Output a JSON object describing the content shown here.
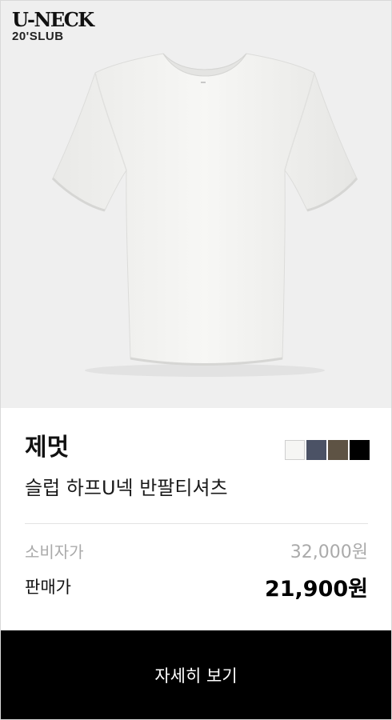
{
  "badge": {
    "title": "U-NECK",
    "subtitle": "20'SLUB"
  },
  "product": {
    "brand": "제멋",
    "name": "슬럽 하프U넥 반팔티셔츠",
    "image_icon": "white-tshirt-image",
    "colors": [
      "#f6f6f4",
      "#4b5265",
      "#5e5344",
      "#000000"
    ]
  },
  "price": {
    "list_label": "소비자가",
    "list_value": "32,000원",
    "sale_label": "판매가",
    "sale_value": "21,900원"
  },
  "cta": {
    "label": "자세히 보기"
  }
}
